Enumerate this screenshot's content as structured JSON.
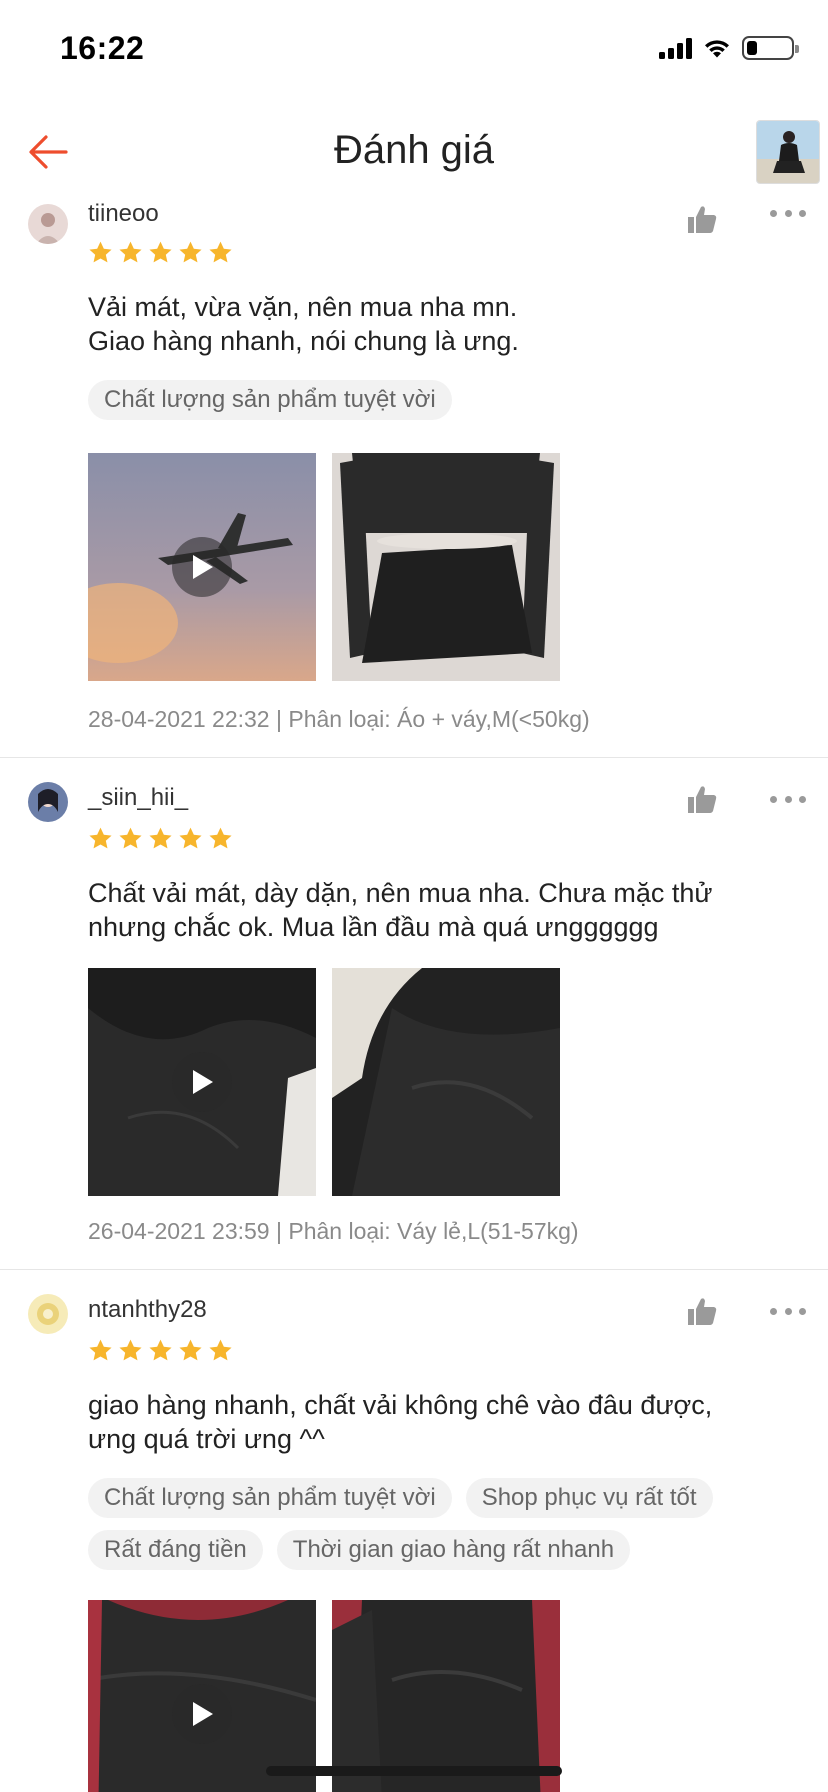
{
  "status_bar": {
    "time": "16:22"
  },
  "header": {
    "title": "Đánh giá",
    "back_icon": "arrow-left-icon",
    "thumbnail_icon": "product-thumbnail"
  },
  "colors": {
    "accent": "#ee4d2d",
    "star": "#f7b52c",
    "tag_bg": "#f2f2f2",
    "meta": "#8a8a8a"
  },
  "reviews": [
    {
      "username": "tiineoo",
      "rating": 5,
      "text_lines": [
        "Vải mát, vừa vặn, nên mua nha mn.",
        "Giao hàng nhanh, nói chung là ưng."
      ],
      "tags": [
        "Chất lượng sản phẩm tuyệt vời"
      ],
      "media": [
        {
          "kind": "video",
          "icon": "play-icon",
          "subject": "airplane-in-sky"
        },
        {
          "kind": "image",
          "subject": "black-swimsuit"
        }
      ],
      "meta": "28-04-2021 22:32 | Phân loại: Áo + váy,M(<50kg)"
    },
    {
      "username": "_siin_hii_",
      "rating": 5,
      "text_lines": [
        "Chất vải mát, dày dặn, nên mua nha. Chưa mặc thử",
        "nhưng chắc ok. Mua lần đầu mà quá ưngggggg"
      ],
      "tags": [],
      "media": [
        {
          "kind": "video",
          "icon": "play-icon",
          "subject": "black-fabric"
        },
        {
          "kind": "image",
          "subject": "black-fabric"
        }
      ],
      "meta": "26-04-2021 23:59 | Phân loại: Váy lẻ,L(51-57kg)"
    },
    {
      "username": "ntanhthy28",
      "rating": 5,
      "text_lines": [
        "giao hàng nhanh, chất vải không chê vào đâu được,",
        "ưng quá trời ưng ^^"
      ],
      "tags": [
        "Chất lượng sản phẩm tuyệt vời",
        "Shop phục vụ rất tốt",
        "Rất đáng tiền",
        "Thời gian giao hàng rất nhanh"
      ],
      "media": [
        {
          "kind": "video",
          "icon": "play-icon",
          "subject": "black-swimsuit-on-red"
        },
        {
          "kind": "image",
          "subject": "black-swimsuit-on-red"
        }
      ],
      "meta": ""
    }
  ]
}
